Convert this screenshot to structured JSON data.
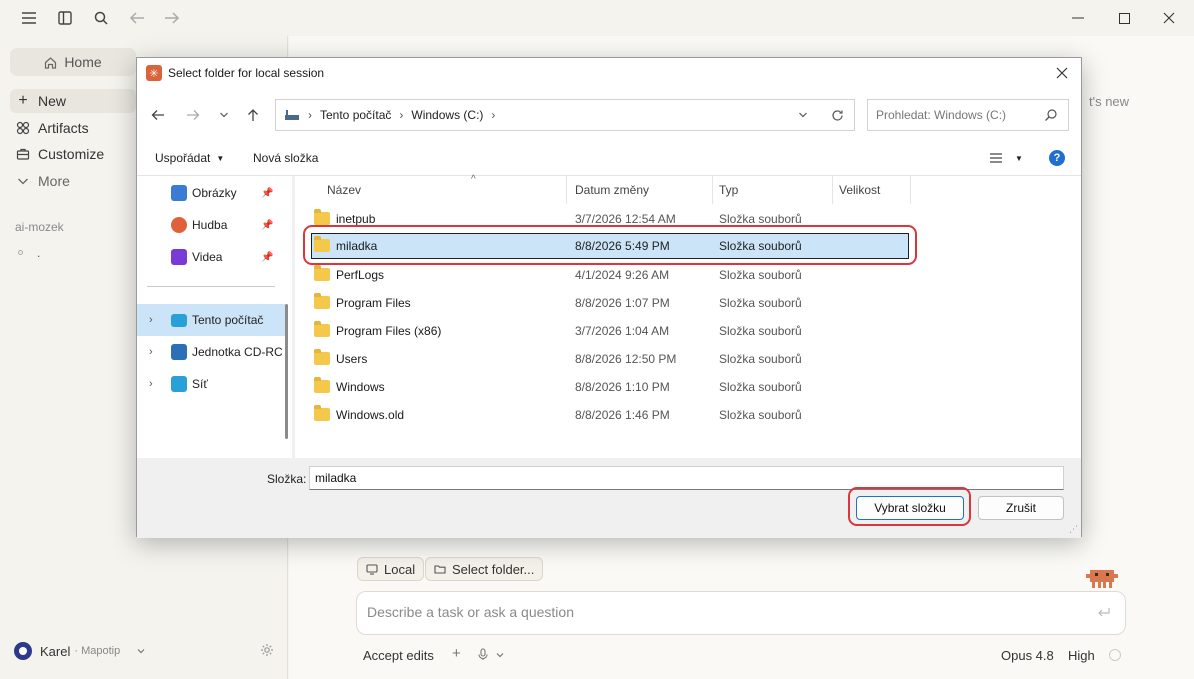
{
  "app": {
    "sidebar": {
      "home": "Home",
      "items": [
        {
          "label": "New",
          "icon": "plus-icon"
        },
        {
          "label": "Artifacts",
          "icon": "artifacts-icon"
        },
        {
          "label": "Customize",
          "icon": "briefcase-icon"
        },
        {
          "label": "More",
          "icon": "chevron-down-icon"
        }
      ],
      "section_title": "ai-mozek",
      "session_item": ".",
      "user_name": "Karel",
      "user_org": "· Mapotip"
    },
    "main": {
      "partial_text": "t's new",
      "chip_local": "Local",
      "chip_folder": "Select folder...",
      "prompt_placeholder": "Describe a task or ask a question",
      "accept_edits": "Accept edits",
      "model": "Opus 4.8",
      "effort": "High"
    }
  },
  "dialog": {
    "title": "Select folder for local session",
    "breadcrumb": [
      "Tento počítač",
      "Windows (C:)"
    ],
    "search_placeholder": "Prohledat: Windows (C:)",
    "toolbar": {
      "organize": "Uspořádat",
      "new_folder": "Nová složka"
    },
    "nav_items": [
      {
        "label": "Obrázky",
        "icon": "pictures-icon",
        "color": "#3a7bd5",
        "pinned": true
      },
      {
        "label": "Hudba",
        "icon": "music-icon",
        "color": "#e0603a",
        "pinned": true
      },
      {
        "label": "Videa",
        "icon": "videos-icon",
        "color": "#7a3ad5",
        "pinned": true
      },
      {
        "label": "Tento počítač",
        "icon": "computer-icon",
        "color": "#2aa0d8",
        "selected": true
      },
      {
        "label": "Jednotka CD-RC",
        "icon": "cd-drive-icon",
        "color": "#2a6fb8"
      },
      {
        "label": "Síť",
        "icon": "network-icon",
        "color": "#2aa0d8"
      }
    ],
    "columns": [
      "Název",
      "Datum změny",
      "Typ",
      "Velikost"
    ],
    "files": [
      {
        "name": "inetpub",
        "date": "3/7/2026 12:54 AM",
        "type": "Složka souborů"
      },
      {
        "name": "miladka",
        "date": "8/8/2026 5:49 PM",
        "type": "Složka souborů",
        "selected": true
      },
      {
        "name": "PerfLogs",
        "date": "4/1/2024 9:26 AM",
        "type": "Složka souborů"
      },
      {
        "name": "Program Files",
        "date": "8/8/2026 1:07 PM",
        "type": "Složka souborů"
      },
      {
        "name": "Program Files (x86)",
        "date": "3/7/2026 1:04 AM",
        "type": "Složka souborů"
      },
      {
        "name": "Users",
        "date": "8/8/2026 12:50 PM",
        "type": "Složka souborů"
      },
      {
        "name": "Windows",
        "date": "8/8/2026 1:10 PM",
        "type": "Složka souborů"
      },
      {
        "name": "Windows.old",
        "date": "8/8/2026 1:46 PM",
        "type": "Složka souborů"
      }
    ],
    "folder_label": "Složka:",
    "folder_value": "miladka",
    "select_button": "Vybrat složku",
    "cancel_button": "Zrušit",
    "highlight_color": "#d9363e"
  }
}
